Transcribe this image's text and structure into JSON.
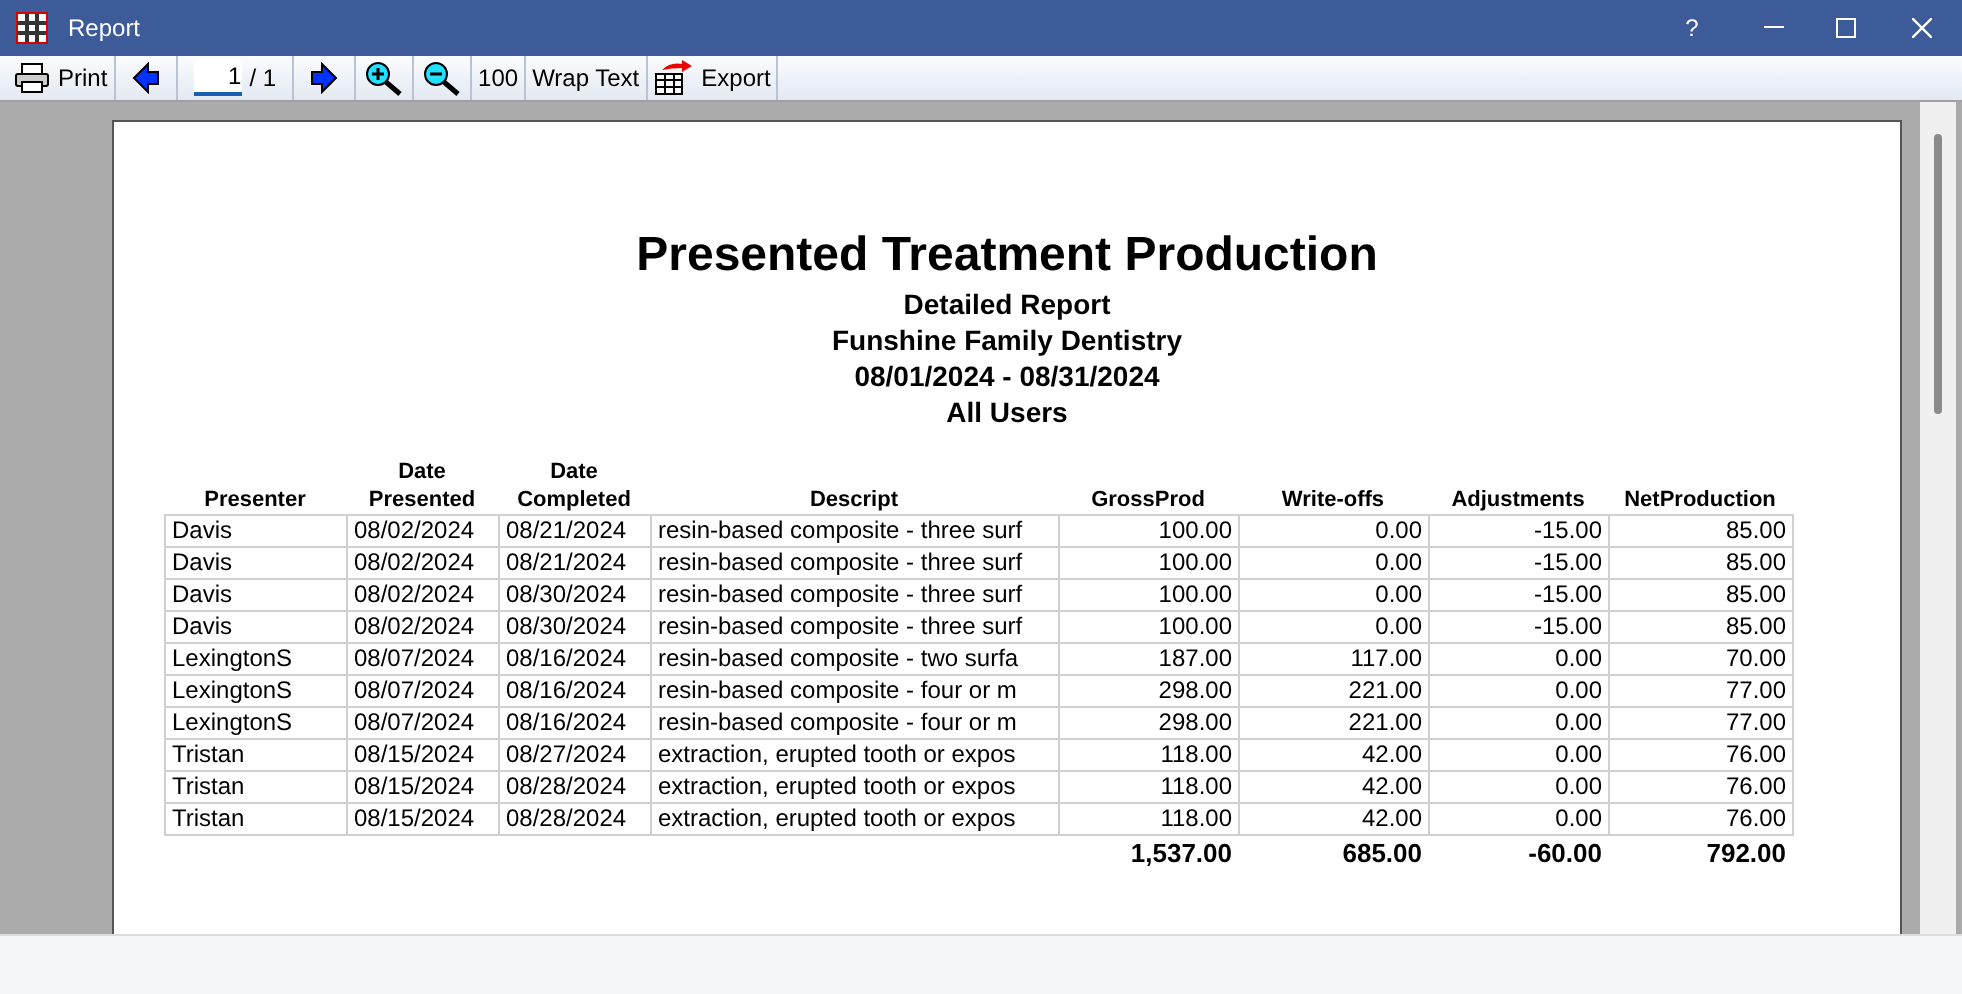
{
  "window": {
    "title": "Report"
  },
  "title_buttons": [
    "?"
  ],
  "toolbar": [
    {
      "kind": "print",
      "label": "Print"
    },
    {
      "kind": "prev"
    },
    {
      "kind": "page",
      "value": "1",
      "total": "/ 1"
    },
    {
      "kind": "next"
    },
    {
      "kind": "zoom_in"
    },
    {
      "kind": "zoom_out"
    },
    {
      "kind": "text",
      "label": "100"
    },
    {
      "kind": "text",
      "label": "Wrap Text"
    },
    {
      "kind": "export",
      "label": "Export"
    }
  ],
  "report": {
    "title": "Presented Treatment Production",
    "subtitles": [
      "Detailed Report",
      "Funshine Family Dentistry",
      "08/01/2024 - 08/31/2024",
      "All Users"
    ],
    "table": {
      "columns": [
        "Presenter",
        "Date Presented",
        "Date Completed",
        "Descript",
        "GrossProd",
        "Write-offs",
        "Adjustments",
        "NetProduction"
      ],
      "rows": [
        [
          "Davis",
          "08/02/2024",
          "08/21/2024",
          "resin-based composite - three surf",
          "100.00",
          "0.00",
          "-15.00",
          "85.00"
        ],
        [
          "Davis",
          "08/02/2024",
          "08/21/2024",
          "resin-based composite - three surf",
          "100.00",
          "0.00",
          "-15.00",
          "85.00"
        ],
        [
          "Davis",
          "08/02/2024",
          "08/30/2024",
          "resin-based composite - three surf",
          "100.00",
          "0.00",
          "-15.00",
          "85.00"
        ],
        [
          "Davis",
          "08/02/2024",
          "08/30/2024",
          "resin-based composite - three surf",
          "100.00",
          "0.00",
          "-15.00",
          "85.00"
        ],
        [
          "LexingtonS",
          "08/07/2024",
          "08/16/2024",
          "resin-based composite - two surfa",
          "187.00",
          "117.00",
          "0.00",
          "70.00"
        ],
        [
          "LexingtonS",
          "08/07/2024",
          "08/16/2024",
          "resin-based composite - four or m",
          "298.00",
          "221.00",
          "0.00",
          "77.00"
        ],
        [
          "LexingtonS",
          "08/07/2024",
          "08/16/2024",
          "resin-based composite - four or m",
          "298.00",
          "221.00",
          "0.00",
          "77.00"
        ],
        [
          "Tristan",
          "08/15/2024",
          "08/27/2024",
          "extraction, erupted tooth or expos",
          "118.00",
          "42.00",
          "0.00",
          "76.00"
        ],
        [
          "Tristan",
          "08/15/2024",
          "08/28/2024",
          "extraction, erupted tooth or expos",
          "118.00",
          "42.00",
          "0.00",
          "76.00"
        ],
        [
          "Tristan",
          "08/15/2024",
          "08/28/2024",
          "extraction, erupted tooth or expos",
          "118.00",
          "42.00",
          "0.00",
          "76.00"
        ]
      ],
      "totals": [
        "1,537.00",
        "685.00",
        "-60.00",
        "792.00"
      ]
    }
  }
}
